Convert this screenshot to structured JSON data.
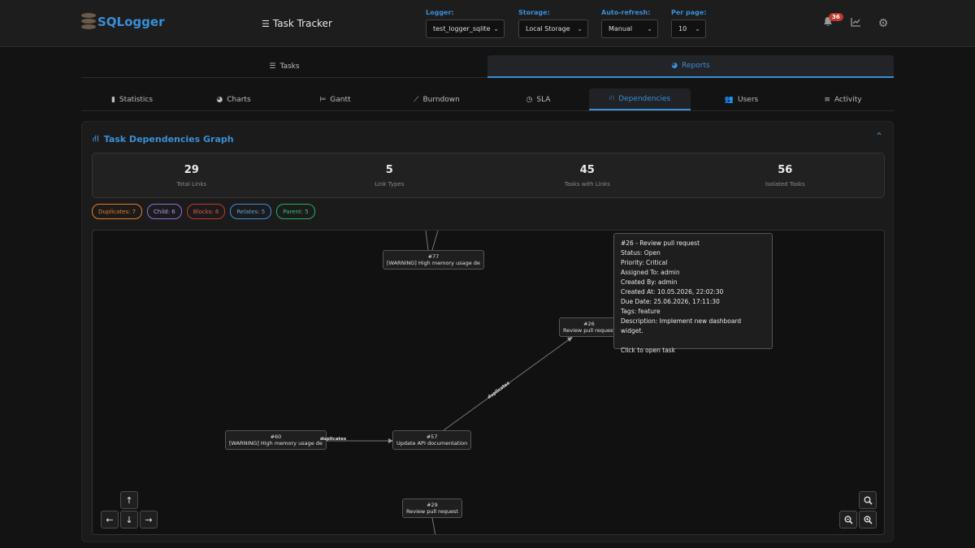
{
  "header": {
    "logo": "SQLogger",
    "app_title": "Task Tracker",
    "logger": {
      "label": "Logger:",
      "value": "test_logger_sqlite"
    },
    "storage": {
      "label": "Storage:",
      "value": "Local Storage"
    },
    "refresh": {
      "label": "Auto-refresh:",
      "value": "Manual"
    },
    "per_page": {
      "label": "Per page:",
      "value": "10"
    },
    "notification_count": "36"
  },
  "main_tabs": [
    {
      "label": "Tasks",
      "icon": "list-check-icon"
    },
    {
      "label": "Reports",
      "icon": "pie-chart-icon"
    }
  ],
  "sub_tabs": [
    {
      "label": "Statistics"
    },
    {
      "label": "Charts"
    },
    {
      "label": "Gantt"
    },
    {
      "label": "Burndown"
    },
    {
      "label": "SLA"
    },
    {
      "label": "Dependencies"
    },
    {
      "label": "Users"
    },
    {
      "label": "Activity"
    }
  ],
  "panel": {
    "title": "Task Dependencies Graph",
    "stats": [
      {
        "value": "29",
        "label": "Total Links"
      },
      {
        "value": "5",
        "label": "Link Types"
      },
      {
        "value": "45",
        "label": "Tasks with Links"
      },
      {
        "value": "56",
        "label": "Isolated Tasks"
      }
    ],
    "legend": [
      {
        "label": "Duplicates: 7",
        "color": "#e67e22"
      },
      {
        "label": "Child: 6",
        "color": "#8e6fd8"
      },
      {
        "label": "Blocks: 6",
        "color": "#c0392b"
      },
      {
        "label": "Relates: 5",
        "color": "#3a8fd6"
      },
      {
        "label": "Parent: 5",
        "color": "#27ae60"
      }
    ]
  },
  "graph": {
    "nodes": {
      "n77": {
        "id": "#77",
        "title": "[WARNING] High memory usage de"
      },
      "n26": {
        "id": "#26",
        "title": "Review pull request"
      },
      "n60": {
        "id": "#60",
        "title": "[WARNING] High memory usage de"
      },
      "n57": {
        "id": "#57",
        "title": "Update API documentation"
      },
      "n29": {
        "id": "#29",
        "title": "Review pull request"
      }
    },
    "edges": {
      "e1": "duplicates",
      "e2": "duplicates"
    },
    "tooltip": {
      "line1": "#26 - Review pull request",
      "line2": "Status: Open",
      "line3": "Priority: Critical",
      "line4": "Assigned To: admin",
      "line5": "Created By: admin",
      "line6": "Created At: 10.05.2026, 22:02:30",
      "line7": "Due Date: 25.06.2026, 17:11:30",
      "line8": "Tags: feature",
      "line9": "Description: Implement new dashboard widget.",
      "line10": "Click to open task"
    }
  }
}
